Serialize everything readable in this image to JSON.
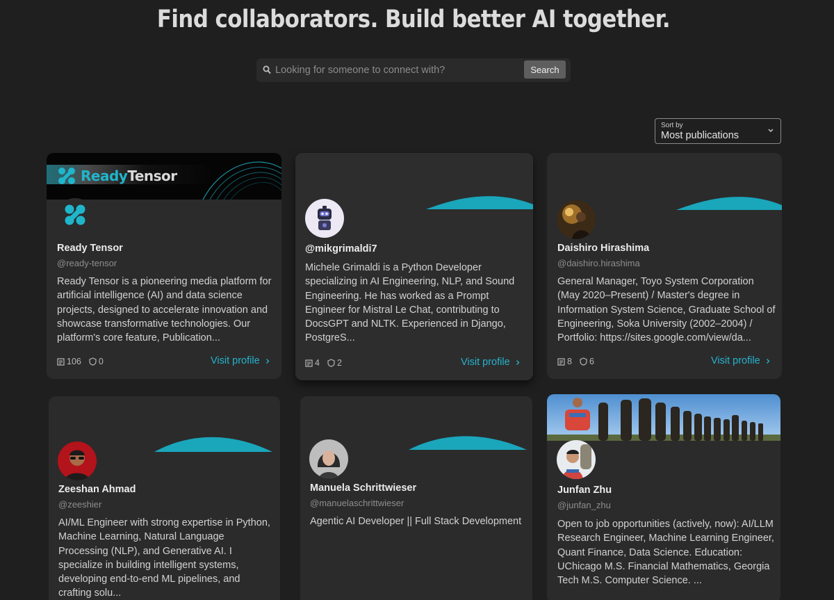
{
  "page": {
    "title": "Find collaborators. Build better AI together."
  },
  "search": {
    "placeholder": "Looking for someone to connect with?",
    "button_label": "Search"
  },
  "sort": {
    "label": "Sort by",
    "value": "Most publications"
  },
  "colors": {
    "background": "#1f1f20",
    "card": "#2b2b2c",
    "accent": "#25b3cb"
  },
  "visit_label": "Visit profile",
  "ready_tensor_banner": {
    "brand_part1": "Ready",
    "brand_part2": "Tensor"
  },
  "profiles": [
    {
      "name": "Ready Tensor",
      "handle": "@ready-tensor",
      "bio": "Ready Tensor is a pioneering media platform for artificial intelligence (AI) and data science projects, designed to accelerate innovation and showcase transformative technologies. Our platform's core feature, Publication...",
      "publications": "106",
      "badges": "0",
      "avatar": "ready-tensor-logo"
    },
    {
      "name": "@mikgrimaldi7",
      "handle": "",
      "bio": "Michele Grimaldi is a Python Developer specializing in AI Engineering, NLP, and Sound Engineering. He has worked as a Prompt Engineer for Mistral Le Chat, contributing to DocsGPT and NLTK. Experienced in Django, PostgreS...",
      "publications": "4",
      "badges": "2",
      "avatar": "robot-avatar"
    },
    {
      "name": "Daishiro Hirashima",
      "handle": "@daishiro.hirashima",
      "bio": "General Manager, Toyo System Corporation (May 2020–Present) / Master's degree in Information System Science, Graduate School of Engineering, Soka University (2002–2004) / Portfolio: https://sites.google.com/view/da...",
      "publications": "8",
      "badges": "6",
      "avatar": "person-photo"
    },
    {
      "name": "Zeeshan Ahmad",
      "handle": "@zeeshier",
      "bio": "AI/ML Engineer with strong expertise in Python, Machine Learning, Natural Language Processing (NLP), and Generative AI. I specialize in building intelligent systems, developing end-to-end ML pipelines, and crafting solu...",
      "avatar": "person-photo"
    },
    {
      "name": "Manuela Schrittwieser",
      "handle": "@manuelaschrittwieser",
      "bio": "Agentic AI Developer || Full Stack Development",
      "avatar": "person-photo"
    },
    {
      "name": "Junfan Zhu",
      "handle": "@junfan_zhu",
      "bio": "Open to job opportunities (actively, now): AI/LLM Research Engineer, Machine Learning Engineer, Quant Finance, Data Science. Education: UChicago M.S. Financial Mathematics, Georgia Tech M.S. Computer Science. ...",
      "avatar": "person-photo"
    }
  ]
}
